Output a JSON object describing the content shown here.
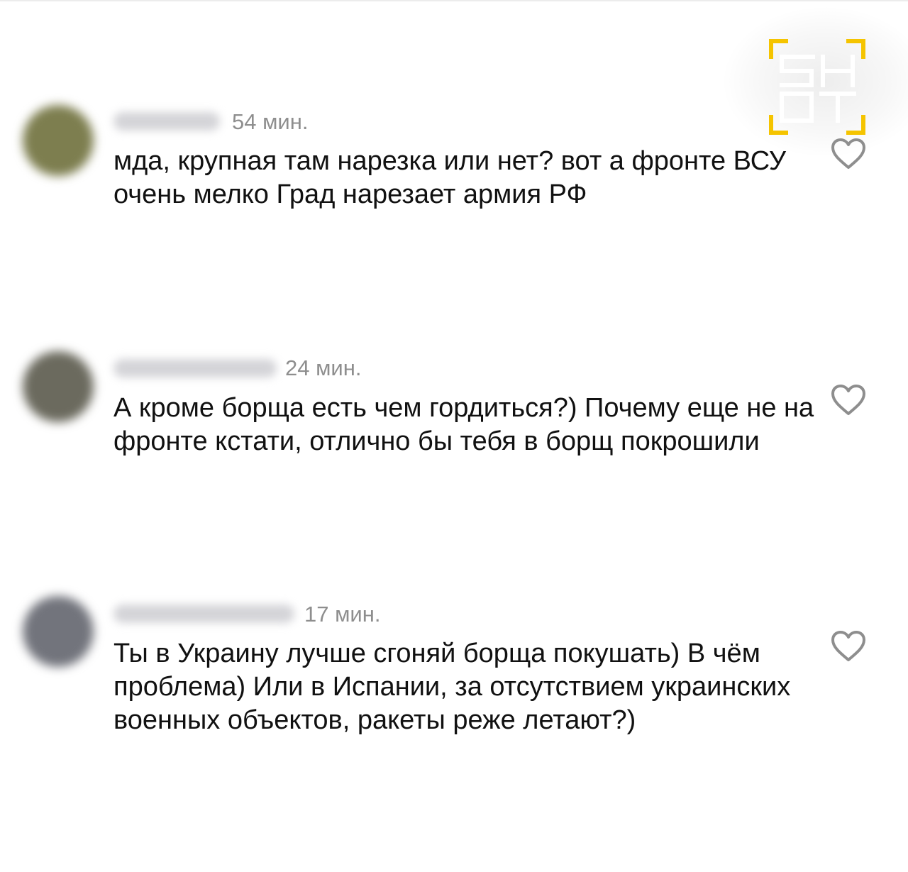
{
  "watermark": {
    "brand": "SHOT",
    "accent_color": "#f5c400"
  },
  "comments": [
    {
      "avatar_color": "#7d7e4f",
      "time": "54 мин.",
      "text": "мда, крупная там нарезка или нет? вот а фронте ВСУ очень мелко Град нарезает армия РФ",
      "like_icon": "heart-outline-icon"
    },
    {
      "avatar_color": "#6b6a5e",
      "time": "24 мин.",
      "text": "А кроме борща есть чем гордиться?) Почему еще не на фронте кстати, отлично бы тебя в борщ покрошили",
      "like_icon": "heart-outline-icon"
    },
    {
      "avatar_color": "#72747c",
      "time": "17 мин.",
      "text": "Ты в Украину лучше сгоняй борща покушать) В чём проблема) Или в Испании, за отсутствием украинских военных объектов, ракеты реже летают?)",
      "like_icon": "heart-outline-icon"
    }
  ]
}
